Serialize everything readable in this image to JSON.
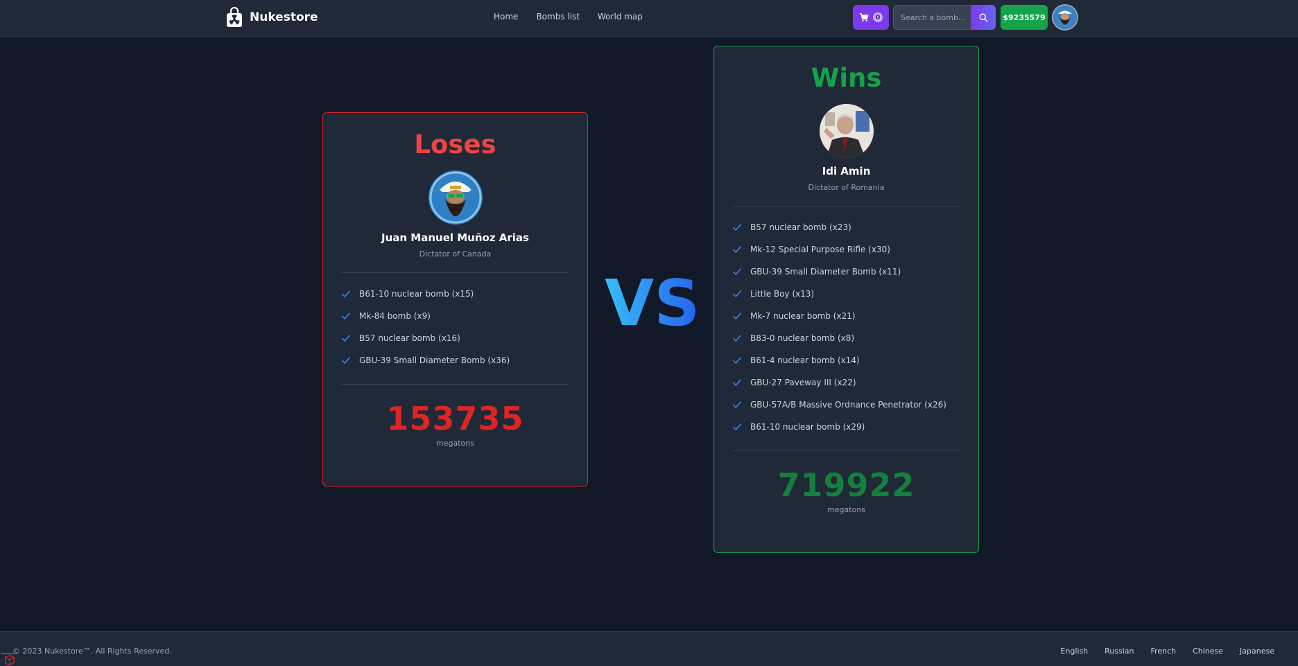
{
  "navbar": {
    "brand": "Nukestore",
    "links": [
      "Home",
      "Bombs list",
      "World map"
    ],
    "cart_count": "0",
    "search_placeholder": "Search a bomb...",
    "balance": "$9235579"
  },
  "loser": {
    "title": "Loses",
    "name": "Juan Manuel Muñoz Arias",
    "role": "Dictator of Canada",
    "bombs": [
      "B61-10 nuclear bomb (x15)",
      "Mk-84 bomb (x9)",
      "B57 nuclear bomb (x16)",
      "GBU-39 Small Diameter Bomb (x36)"
    ],
    "score": "153735",
    "unit": "megatons"
  },
  "vs": "VS",
  "winner": {
    "title": "Wins",
    "name": "Idi Amin",
    "role": "Dictator of Romania",
    "bombs": [
      "B57 nuclear bomb (x23)",
      "Mk-12 Special Purpose Rifle (x30)",
      "GBU-39 Small Diameter Bomb (x11)",
      "Little Boy (x13)",
      "Mk-7 nuclear bomb (x21)",
      "B83-0 nuclear bomb (x8)",
      "B61-4 nuclear bomb (x14)",
      "GBU-27 Paveway III (x22)",
      "GBU-57A/B Massive Ordnance Penetrator (x26)",
      "B61-10 nuclear bomb (x29)"
    ],
    "score": "719922",
    "unit": "megatons"
  },
  "footer": {
    "copyright": "© 2023 Nukestore™. All Rights Reserved.",
    "languages": [
      "English",
      "Russian",
      "French",
      "Chinese",
      "Japanese"
    ]
  },
  "colors": {
    "background": "#111827",
    "panel": "#1f2937",
    "lose": "#dc2626",
    "win": "#16a34a",
    "accent": "#7c3aed",
    "check": "#3b82f6"
  },
  "icons": {
    "brand": "nuke-bag-icon",
    "cart": "cart-icon",
    "search": "search-icon",
    "check": "check-icon"
  }
}
